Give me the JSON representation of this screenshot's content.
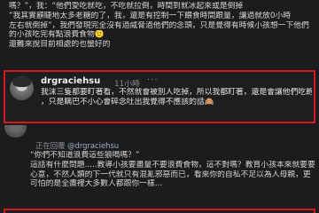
{
  "top_comment": {
    "lines": [
      "嗎？”，我：“他們愛吃就吃，不吃就拉倒，時間到就冰起來或是倒掉",
      "”我其實顧睫地太多老糖的了，我，還是有控制一下餵食時間跟量，讓過就放0小時",
      "左右就倒掉”，我們發現完全沒有過威脅過他們的念頭，只是覺得有時候小孩想一下他們",
      "的小孩吃完有點浪費食物🙂",
      "還難來說目前相處的也蠻好的"
    ]
  },
  "highlighted_reply": {
    "username": "drgraciehsu",
    "time": "11小時",
    "more": "···",
    "lines": [
      "我沫三隻都要盯著看，不然就會被別人吃掉，所以我都盯著，還是會讓他們吃飽",
      "，只是瞒巴不小心會碎念吐出我覺得不應該的話🙈"
    ]
  },
  "lower_reply": {
    "replying_label": "正在回覆",
    "replying_to": "@drgraciehsu",
    "lines": [
      "“你們不知道浪費這些狼喝嗎？”",
      "這話有什麼問題.....教導小孩要盡量不要浪費食物，這不對嗎？教育小孩本來就要要盡",
      "心意，不然人類的下一代就只有混亂邪惡而已，看來你的自私不足以為人母親，更",
      "可怕的是全盡裡大多數人都跟你一樣..."
    ]
  }
}
